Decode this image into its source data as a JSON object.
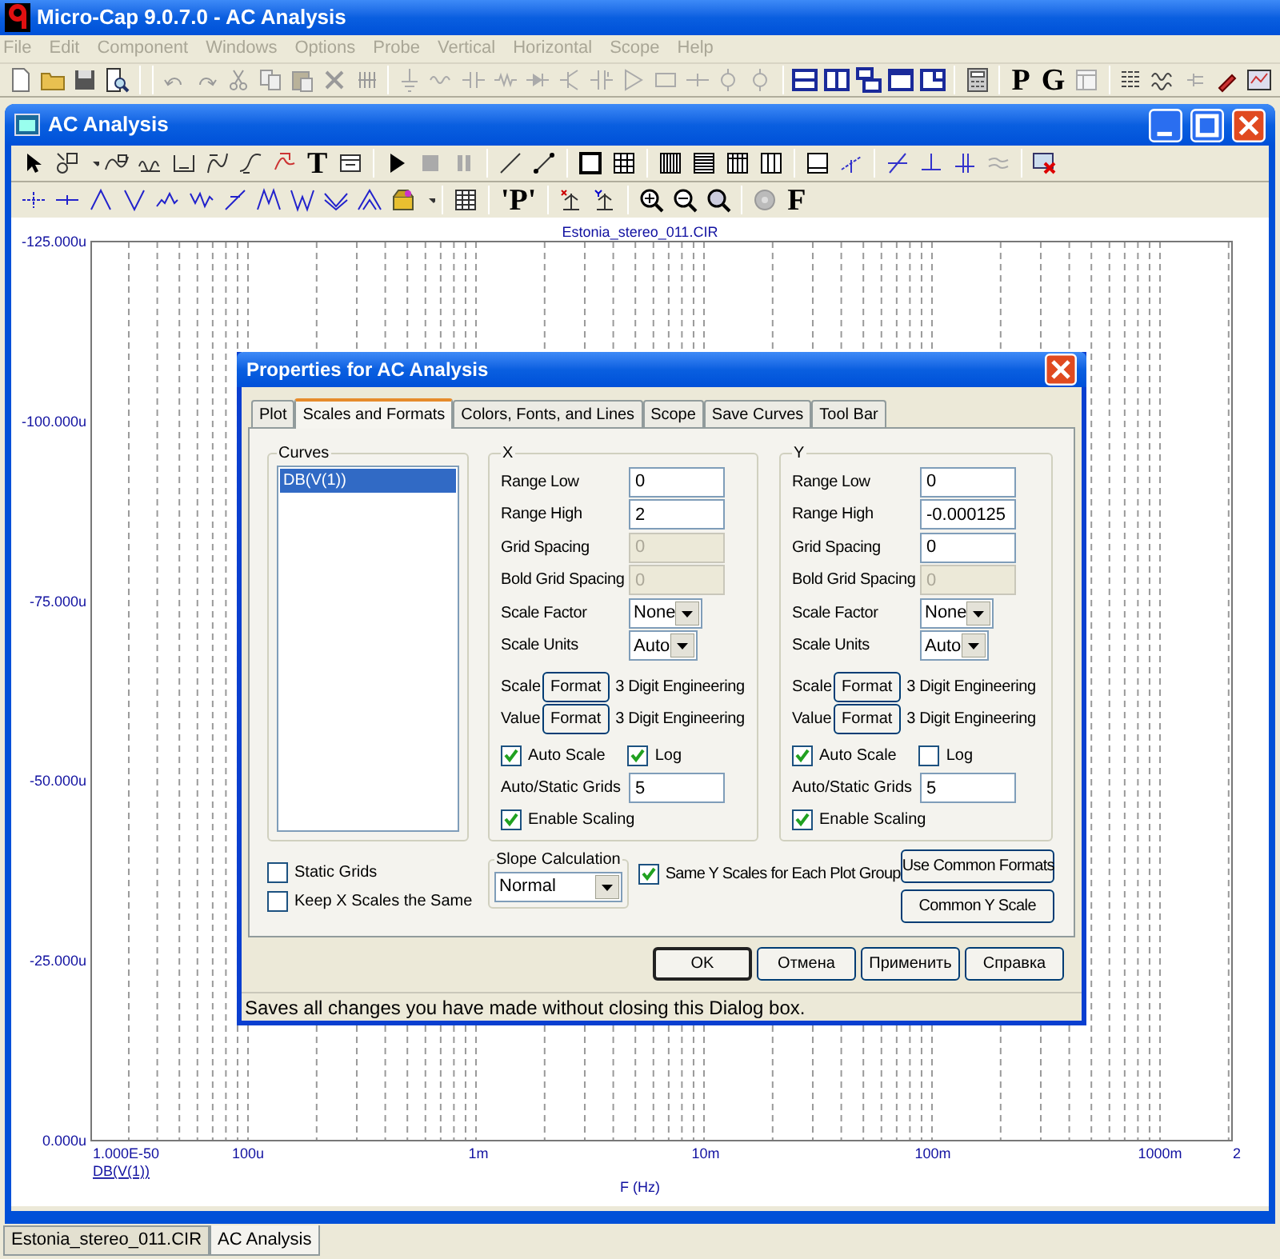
{
  "window": {
    "title": "Micro-Cap 9.0.7.0 - AC Analysis"
  },
  "menu": [
    {
      "label": "File",
      "disabled": true
    },
    {
      "label": "Edit",
      "disabled": true
    },
    {
      "label": "Component",
      "disabled": true
    },
    {
      "label": "Windows",
      "disabled": true
    },
    {
      "label": "Options",
      "disabled": true
    },
    {
      "label": "Probe",
      "disabled": true
    },
    {
      "label": "Vertical",
      "disabled": true
    },
    {
      "label": "Horizontal",
      "disabled": true
    },
    {
      "label": "Scope",
      "disabled": true
    },
    {
      "label": "Help",
      "disabled": true
    }
  ],
  "main_toolbar": {
    "letter_buttons": [
      "P",
      "G"
    ]
  },
  "analysis_window": {
    "title": "AC Analysis",
    "toolbar_letters": [
      "T"
    ],
    "toolbar2_letters": [
      "'P'",
      "F"
    ],
    "plot": {
      "title": "Estonia_stereo_011.CIR",
      "y_ticks": [
        "-125.000u",
        "-100.000u",
        "-75.000u",
        "-50.000u",
        "-25.000u",
        "0.000u"
      ],
      "x_ticks": [
        "1.000E-50",
        "100u",
        "1m",
        "10m",
        "100m",
        "1000m",
        "2"
      ],
      "curve_label": "DB(V(1))",
      "x_label": "F (Hz)"
    }
  },
  "dialog": {
    "title": "Properties for AC Analysis",
    "tabs": [
      {
        "label": "Plot",
        "selected": false
      },
      {
        "label": "Scales and Formats",
        "selected": true
      },
      {
        "label": "Colors, Fonts, and Lines",
        "selected": false
      },
      {
        "label": "Scope",
        "selected": false
      },
      {
        "label": "Save Curves",
        "selected": false
      },
      {
        "label": "Tool Bar",
        "selected": false
      }
    ],
    "curves": {
      "label": "Curves",
      "items": [
        {
          "label": "DB(V(1))",
          "selected": true
        }
      ]
    },
    "axes": [
      {
        "label": "X",
        "fields": [
          {
            "kind": "input",
            "label": "Range Low",
            "value": "0",
            "disabled": false
          },
          {
            "kind": "input",
            "label": "Range High",
            "value": "2",
            "disabled": false
          },
          {
            "kind": "input",
            "label": "Grid Spacing",
            "value": "0",
            "disabled": true
          },
          {
            "kind": "input",
            "label": "Bold Grid Spacing",
            "value": "0",
            "disabled": true
          },
          {
            "kind": "select",
            "label": "Scale Factor",
            "value": "None"
          },
          {
            "kind": "select",
            "label": "Scale Units",
            "value": "Auto"
          }
        ],
        "formats": [
          {
            "label": "Scale",
            "button": "Format",
            "value": "3 Digit Engineering"
          },
          {
            "label": "Value",
            "button": "Format",
            "value": "3 Digit Engineering"
          }
        ],
        "auto_scale": {
          "label": "Auto Scale",
          "checked": true
        },
        "log": {
          "label": "Log",
          "checked": true
        },
        "grids": {
          "label": "Auto/Static Grids",
          "value": "5"
        },
        "enable_scaling": {
          "label": "Enable Scaling",
          "checked": true
        }
      },
      {
        "label": "Y",
        "fields": [
          {
            "kind": "input",
            "label": "Range Low",
            "value": "0",
            "disabled": false
          },
          {
            "kind": "input",
            "label": "Range High",
            "value": "-0.000125",
            "disabled": false
          },
          {
            "kind": "input",
            "label": "Grid Spacing",
            "value": "0",
            "disabled": false
          },
          {
            "kind": "input",
            "label": "Bold Grid Spacing",
            "value": "0",
            "disabled": true
          },
          {
            "kind": "select",
            "label": "Scale Factor",
            "value": "None"
          },
          {
            "kind": "select",
            "label": "Scale Units",
            "value": "Auto"
          }
        ],
        "formats": [
          {
            "label": "Scale",
            "button": "Format",
            "value": "3 Digit Engineering"
          },
          {
            "label": "Value",
            "button": "Format",
            "value": "3 Digit Engineering"
          }
        ],
        "auto_scale": {
          "label": "Auto Scale",
          "checked": true
        },
        "log": {
          "label": "Log",
          "checked": false
        },
        "grids": {
          "label": "Auto/Static Grids",
          "value": "5"
        },
        "enable_scaling": {
          "label": "Enable Scaling",
          "checked": true
        }
      }
    ],
    "options": [
      {
        "label": "Static Grids",
        "checked": false
      },
      {
        "label": "Keep X Scales the Same",
        "checked": false
      }
    ],
    "slope": {
      "label": "Slope Calculation",
      "value": "Normal"
    },
    "same_y": {
      "label": "Same Y Scales for Each Plot Group",
      "checked": true
    },
    "side_buttons": [
      "Use Common Formats",
      "Common Y Scale"
    ],
    "buttons": [
      {
        "label": "OK",
        "default": true
      },
      {
        "label": "Отмена",
        "default": false
      },
      {
        "label": "Применить",
        "default": false
      },
      {
        "label": "Справка",
        "default": false
      }
    ],
    "status": "Saves all changes you have made without closing this Dialog box."
  },
  "document_tabs": [
    {
      "label": "Estonia_stereo_011.CIR",
      "selected": false
    },
    {
      "label": "AC Analysis",
      "selected": true
    }
  ]
}
